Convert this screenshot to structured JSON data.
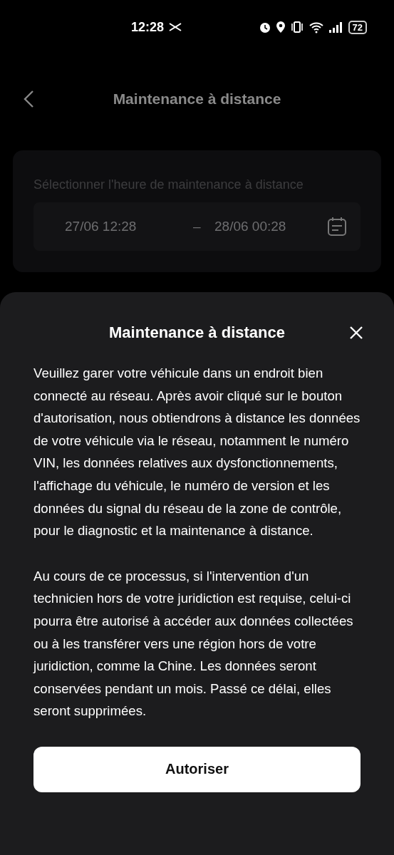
{
  "status_bar": {
    "time": "12:28",
    "battery": "72"
  },
  "header": {
    "title": "Maintenance à distance"
  },
  "time_card": {
    "label": "Sélectionner l'heure de maintenance à distance",
    "start": "27/06 12:28",
    "separator": "–",
    "end": "28/06 00:28"
  },
  "sheet": {
    "title": "Maintenance à distance",
    "paragraphs": [
      "Veuillez garer votre véhicule dans un endroit bien connecté au réseau. Après avoir cliqué sur le bouton d'autorisation, nous obtiendrons à distance les données de votre véhicule via le réseau, notamment le numéro VIN, les données relatives aux dysfonctionnements, l'affichage du véhicule, le numéro de version et les données du signal du réseau de la zone de contrôle, pour le diagnostic et la maintenance à distance.",
      "Au cours de ce processus, si l'intervention d'un technicien hors de votre juridiction est requise, celui-ci pourra être autorisé à accéder aux données collectées ou à les transférer vers une région hors de votre juridiction, comme la Chine. Les données seront conservées pendant un mois. Passé ce délai, elles seront supprimées."
    ],
    "button": "Autoriser"
  }
}
